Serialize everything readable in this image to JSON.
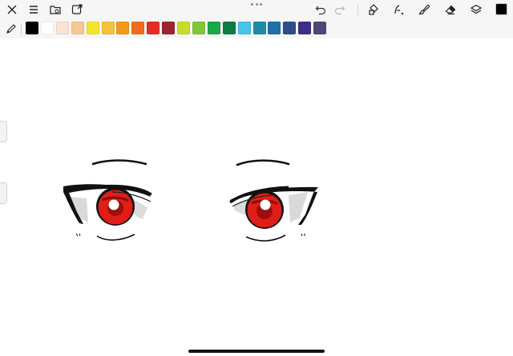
{
  "toolbar": {
    "icons": [
      "close-icon",
      "menu-icon",
      "gallery-icon",
      "export-icon",
      "undo-icon",
      "redo-icon",
      "transform-icon",
      "adjust-icon",
      "brush-icon",
      "eraser-icon",
      "layers-icon"
    ],
    "current_color": "#000000"
  },
  "palette": {
    "colors": [
      "#000000",
      "#ffffff",
      "#f9e4d4",
      "#f7c892",
      "#f5e52a",
      "#f6c23a",
      "#f39a18",
      "#f46b1f",
      "#e12f25",
      "#9d2431",
      "#c7dd2a",
      "#7ec83a",
      "#1aa84a",
      "#0f7a45",
      "#46c4ea",
      "#1e8ca6",
      "#1f6fa8",
      "#2d4e8a",
      "#3a2f86",
      "#4e4876"
    ]
  },
  "artwork": {
    "subject": "anime eyes",
    "iris_color": "#e01d18",
    "line_color": "#111111"
  }
}
